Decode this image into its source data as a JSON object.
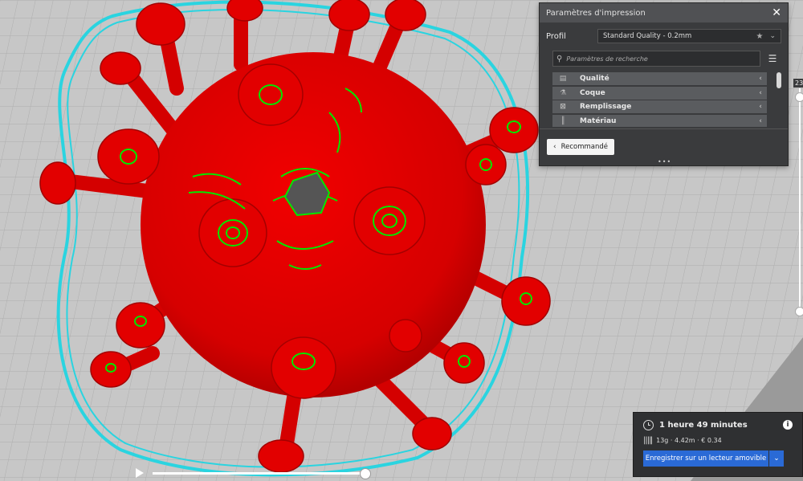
{
  "panel": {
    "title": "Paramètres d'impression",
    "profile_label": "Profil",
    "profile_value": "Standard Quality - 0.2mm",
    "search_placeholder": "Paramètres de recherche",
    "categories": [
      {
        "label": "Qualité",
        "icon": "quality-icon"
      },
      {
        "label": "Coque",
        "icon": "shell-icon"
      },
      {
        "label": "Remplissage",
        "icon": "infill-icon"
      },
      {
        "label": "Matériau",
        "icon": "material-icon"
      }
    ],
    "recommended_label": "Recommandé"
  },
  "layer_label": "23",
  "job": {
    "time": "1 heure 49 minutes",
    "materials": "13g · 4.42m · € 0.34",
    "save_label": "Enregistrer sur un lecteur amovible"
  },
  "colors": {
    "model_red": "#e50000",
    "infill_green": "#00e800",
    "skirt_cyan": "#2ad4e0",
    "accent_blue": "#2a6ad6",
    "grid_bg": "#c7c7c7"
  }
}
